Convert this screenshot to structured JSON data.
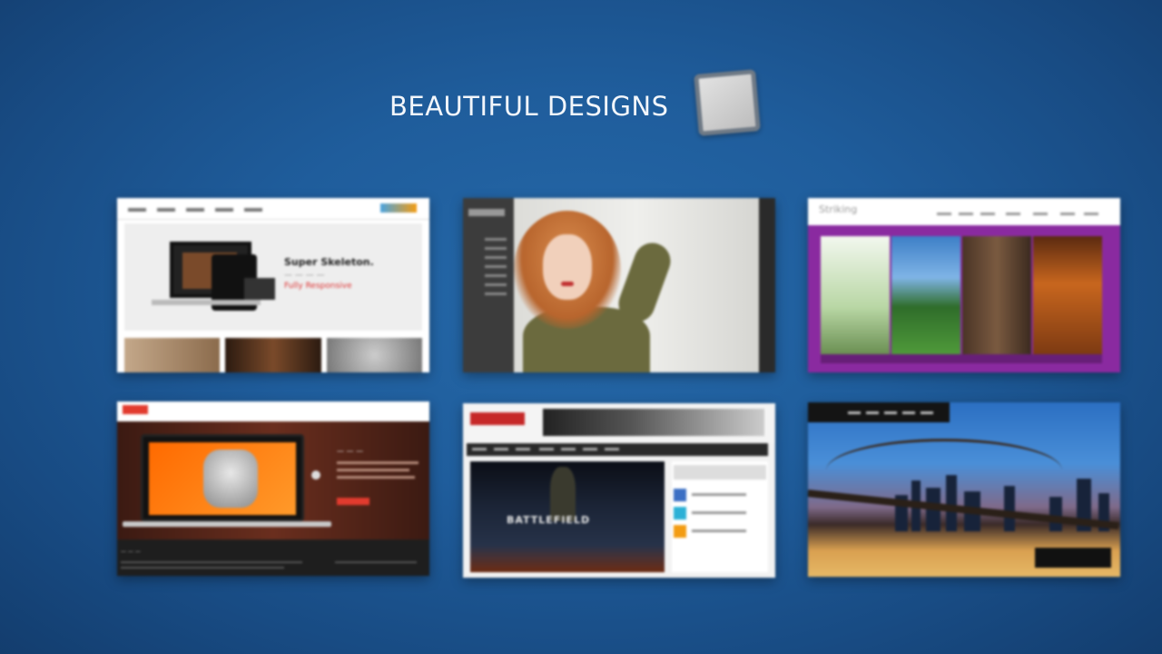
{
  "headline": "BEAUTIFUL DESIGNS",
  "colors": {
    "background": "#1f5d9c",
    "headline": "#f2f6fb",
    "accent_red": "#e23b2e",
    "purple_band": "#8a2aa0"
  },
  "logo": {
    "icon": "app-logo-square-icon"
  },
  "thumbnails": [
    {
      "id": "super-skeleton",
      "headline": "Super Skeleton.",
      "subline": "Fully Responsive"
    },
    {
      "id": "model-portfolio"
    },
    {
      "id": "striking",
      "logo": "Striking"
    },
    {
      "id": "dark-laptop"
    },
    {
      "id": "biolanced",
      "feature_title": "BATTLEFIELD"
    },
    {
      "id": "city-bridge"
    }
  ]
}
